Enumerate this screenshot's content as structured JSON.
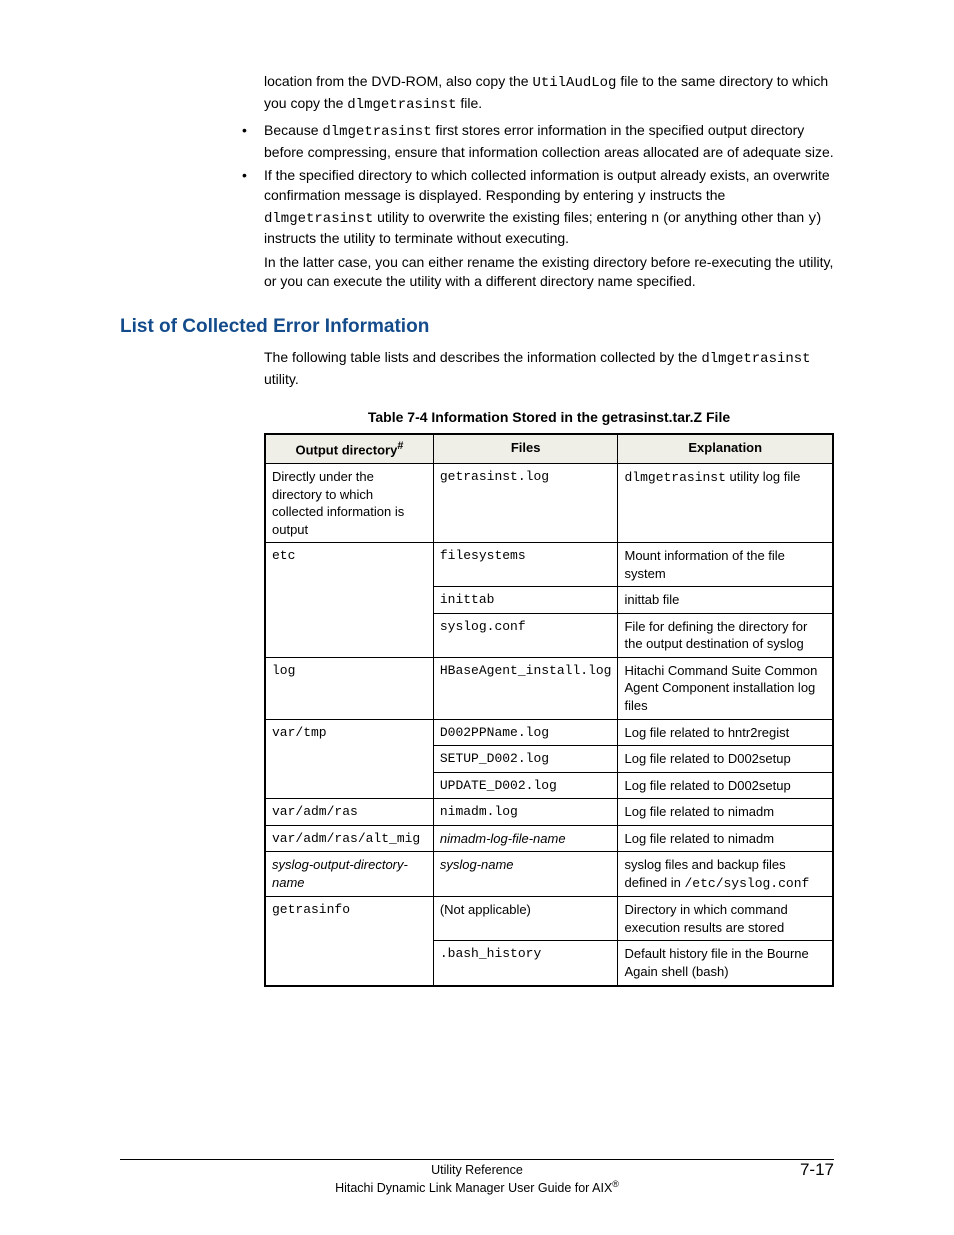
{
  "intro": {
    "p1a": "location from the DVD-ROM, also copy the ",
    "p1code": "UtilAudLog",
    "p1b": " file to the same directory to which you copy the ",
    "p1code2": "dlmgetrasinst",
    "p1c": " file."
  },
  "bullets": {
    "b1a": "Because ",
    "b1code": "dlmgetrasinst",
    "b1b": " first stores error information in the specified output directory before compressing, ensure that information collection areas allocated are of adequate size.",
    "b2a": "If the specified directory to which collected information is output already exists, an overwrite confirmation message is displayed. Responding by entering ",
    "b2y": "y",
    "b2b": " instructs the ",
    "b2code": "dlmgetrasinst",
    "b2c": " utility to overwrite the existing files; entering ",
    "b2n": "n",
    "b2d": " (or anything other than ",
    "b2y2": "y",
    "b2e": ") instructs the utility to terminate without executing.",
    "b2sub": "In the latter case, you can either rename the existing directory before re-executing the utility, or you can execute the utility with a different directory name specified."
  },
  "heading": "List of Collected Error Information",
  "lead": {
    "a": "The following table lists and describes the information collected by the ",
    "code": "dlmgetrasinst",
    "b": " utility."
  },
  "tableCaption": "Table 7-4 Information Stored in the getrasinst.tar.Z File",
  "tableHeaders": {
    "h1a": "Output directory",
    "h1sup": "#",
    "h2": "Files",
    "h3": "Explanation"
  },
  "rows": [
    {
      "dir": "Directly under the directory to which collected information is output",
      "dirCode": false,
      "file": "getrasinst.log",
      "fileCode": true,
      "expA": "",
      "expCode": "dlmgetrasinst",
      "expB": " utility log file",
      "rowspan": 1
    },
    {
      "dir": "etc",
      "dirCode": true,
      "file": "filesystems",
      "fileCode": true,
      "exp": "Mount information of the file system",
      "rowspan": 3
    },
    {
      "file": "inittab",
      "fileCode": true,
      "exp": "inittab file"
    },
    {
      "file": "syslog.conf",
      "fileCode": true,
      "exp": "File for defining the directory for the output destination of syslog"
    },
    {
      "dir": "log",
      "dirCode": true,
      "file": "HBaseAgent_install.log",
      "fileCode": true,
      "exp": "Hitachi Command Suite Common Agent Component installation log files",
      "rowspan": 1
    },
    {
      "dir": "var/tmp",
      "dirCode": true,
      "file": "D002PPName.log",
      "fileCode": true,
      "exp": "Log file related to hntr2regist",
      "rowspan": 3
    },
    {
      "file": "SETUP_D002.log",
      "fileCode": true,
      "exp": "Log file related to D002setup"
    },
    {
      "file": "UPDATE_D002.log",
      "fileCode": true,
      "exp": "Log file related to D002setup"
    },
    {
      "dir": "var/adm/ras",
      "dirCode": true,
      "file": "nimadm.log",
      "fileCode": true,
      "exp": "Log file related to nimadm",
      "rowspan": 1
    },
    {
      "dir": "var/adm/ras/alt_mig",
      "dirCode": true,
      "file": "nimadm-log-file-name",
      "fileItalic": true,
      "exp": "Log file related to nimadm",
      "rowspan": 1
    },
    {
      "dir": "syslog-output-directory-name",
      "dirItalic": true,
      "file": "syslog-name",
      "fileItalic": true,
      "expA": "syslog files and backup files defined in ",
      "expCode": "/etc/syslog.conf",
      "expB": "",
      "rowspan": 1
    },
    {
      "dir": "getrasinfo",
      "dirCode": true,
      "file": "(Not applicable)",
      "exp": "Directory in which command execution results are stored",
      "rowspan": 2
    },
    {
      "file": ".bash_history",
      "fileCode": true,
      "exp": "Default history file in the Bourne Again shell (bash)"
    }
  ],
  "footer": {
    "center": "Utility Reference",
    "pagenum": "7-17",
    "sub": "Hitachi Dynamic Link Manager User Guide for AIX",
    "reg": "®"
  }
}
